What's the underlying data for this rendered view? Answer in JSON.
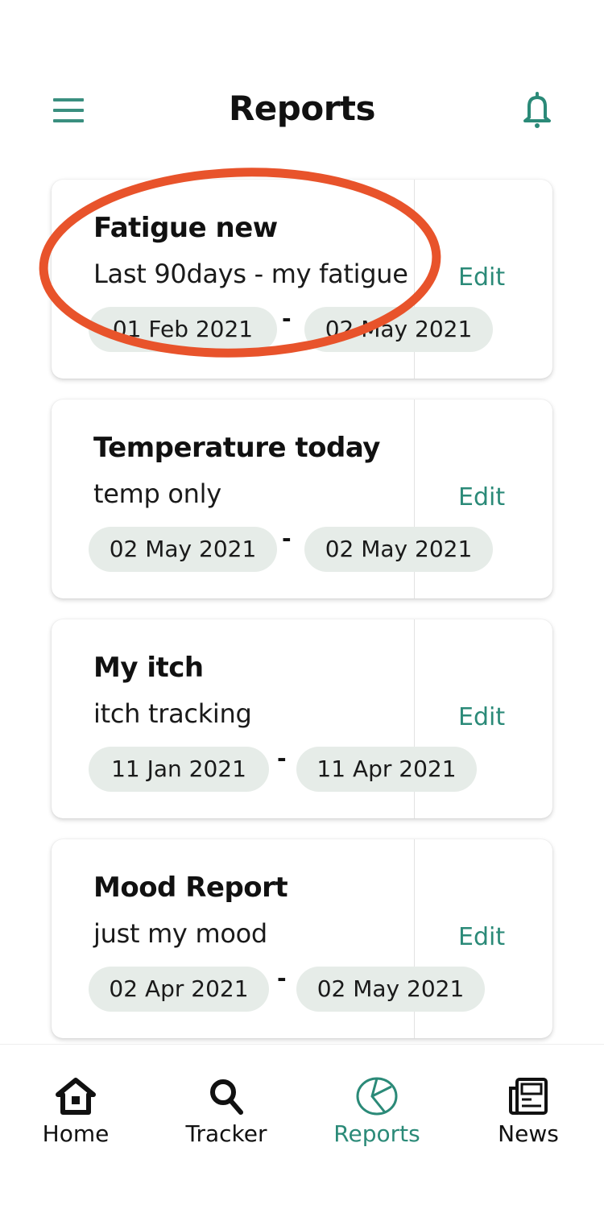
{
  "header": {
    "title": "Reports",
    "menu_icon": "hamburger-menu-icon",
    "notification_icon": "bell-icon"
  },
  "accent_color": "#2b8a78",
  "annotation_color": "#e8532b",
  "reports": [
    {
      "title": "Fatigue new",
      "subtitle": "Last 90days - my fatigue",
      "start": "01 Feb 2021",
      "end": "02 May 2021",
      "edit": "Edit"
    },
    {
      "title": "Temperature today",
      "subtitle": "temp only",
      "start": "02 May 2021",
      "end": "02 May 2021",
      "edit": "Edit"
    },
    {
      "title": "My itch",
      "subtitle": "itch tracking",
      "start": "11 Jan 2021",
      "end": "11 Apr 2021",
      "edit": "Edit"
    },
    {
      "title": "Mood Report",
      "subtitle": "just my mood",
      "start": "02 Apr 2021",
      "end": "02 May 2021",
      "edit": "Edit"
    }
  ],
  "range_separator": "-",
  "bottom_nav": [
    {
      "label": "Home",
      "icon": "home-icon",
      "active": false
    },
    {
      "label": "Tracker",
      "icon": "search-icon",
      "active": false
    },
    {
      "label": "Reports",
      "icon": "pie-chart-icon",
      "active": true
    },
    {
      "label": "News",
      "icon": "newspaper-icon",
      "active": false
    }
  ]
}
